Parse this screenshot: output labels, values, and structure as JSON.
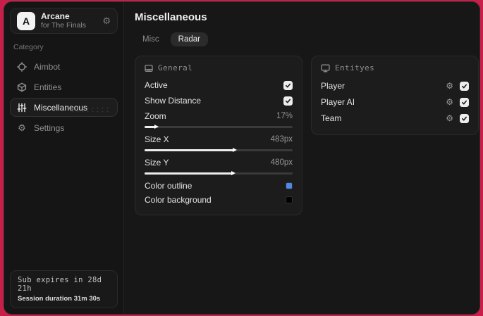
{
  "colors": {
    "backdrop_red": "#c81e4a",
    "checkbox": "#ededed",
    "swatch_outline": "#4e8be4",
    "swatch_background": "#000000"
  },
  "sidebar": {
    "brand": {
      "initial": "A",
      "title": "Arcane",
      "subtitle": "for The Finals"
    },
    "category_label": "Category",
    "items": [
      {
        "label": "Aimbot",
        "icon": "crosshair-icon",
        "active": false
      },
      {
        "label": "Entities",
        "icon": "cube-icon",
        "active": false
      },
      {
        "label": "Miscellaneous",
        "icon": "sliders-icon",
        "active": true
      },
      {
        "label": "Settings",
        "icon": "gear-icon",
        "active": false
      }
    ],
    "footer": {
      "line1": "Sub expires in 28d 21h",
      "line2": "Session duration 31m 30s"
    }
  },
  "main": {
    "title": "Miscellaneous",
    "tabs": [
      {
        "label": "Misc",
        "active": false
      },
      {
        "label": "Radar",
        "active": true
      }
    ],
    "general": {
      "title": "General",
      "rows": [
        {
          "type": "checkbox",
          "label": "Active",
          "checked": true
        },
        {
          "type": "checkbox",
          "label": "Show Distance",
          "checked": true
        },
        {
          "type": "slider",
          "label": "Zoom",
          "value": "17%",
          "fill": "7%"
        },
        {
          "type": "slider",
          "label": "Size X",
          "value": "483px",
          "fill": "60%"
        },
        {
          "type": "slider",
          "label": "Size Y",
          "value": "480px",
          "fill": "59%"
        },
        {
          "type": "color",
          "label": "Color outline",
          "color": "#4e8be4"
        },
        {
          "type": "color",
          "label": "Color background",
          "color": "#000000"
        }
      ]
    },
    "entities": {
      "title": "Entityes",
      "rows": [
        {
          "label": "Player",
          "checked": true
        },
        {
          "label": "Player AI",
          "checked": true
        },
        {
          "label": "Team",
          "checked": true
        }
      ]
    }
  }
}
